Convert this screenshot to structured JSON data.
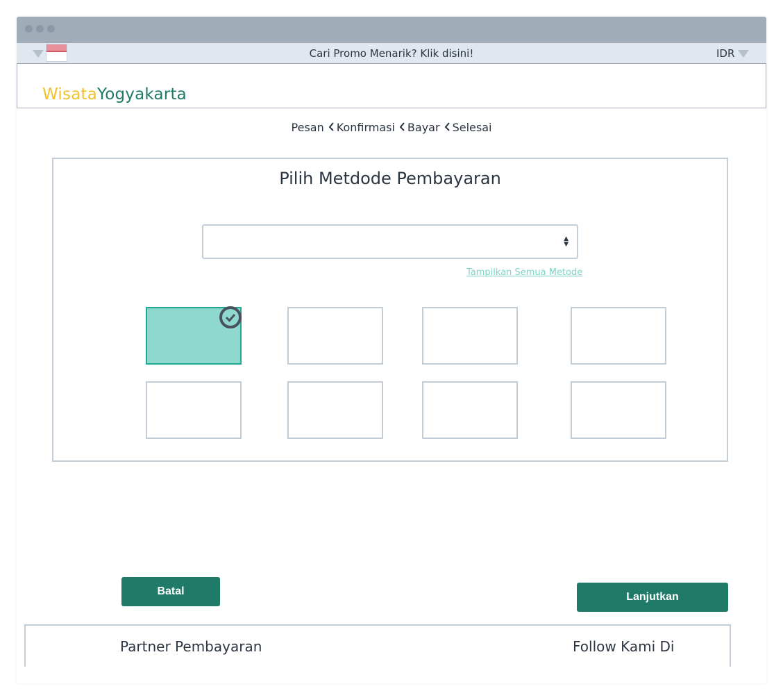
{
  "window": {
    "controls": [
      "dot",
      "dot",
      "dot"
    ]
  },
  "promo_bar": {
    "text": "Cari Promo Menarik? Klik disini!",
    "currency": "IDR",
    "language_flag": "indonesia-flag-icon"
  },
  "header": {
    "logo_part1": "Wisata",
    "logo_part2": "Yogyakarta",
    "logo_color1": "#f2c12e",
    "logo_color2": "#1f7a67"
  },
  "steps": {
    "items": [
      "Pesan",
      "Konfirmasi",
      "Bayar",
      "Selesai"
    ]
  },
  "payment": {
    "title": "Pilih Metdode Pembayaran",
    "select_value": "",
    "show_all_link": "Tampilkan Semua Metode",
    "selected_index": 0,
    "method_count": 8
  },
  "buttons": {
    "cancel": "Batal",
    "next": "Lanjutkan",
    "color": "#1f7a67"
  },
  "footer": {
    "partners": "Partner Pembayaran",
    "follow": "Follow Kami Di"
  }
}
